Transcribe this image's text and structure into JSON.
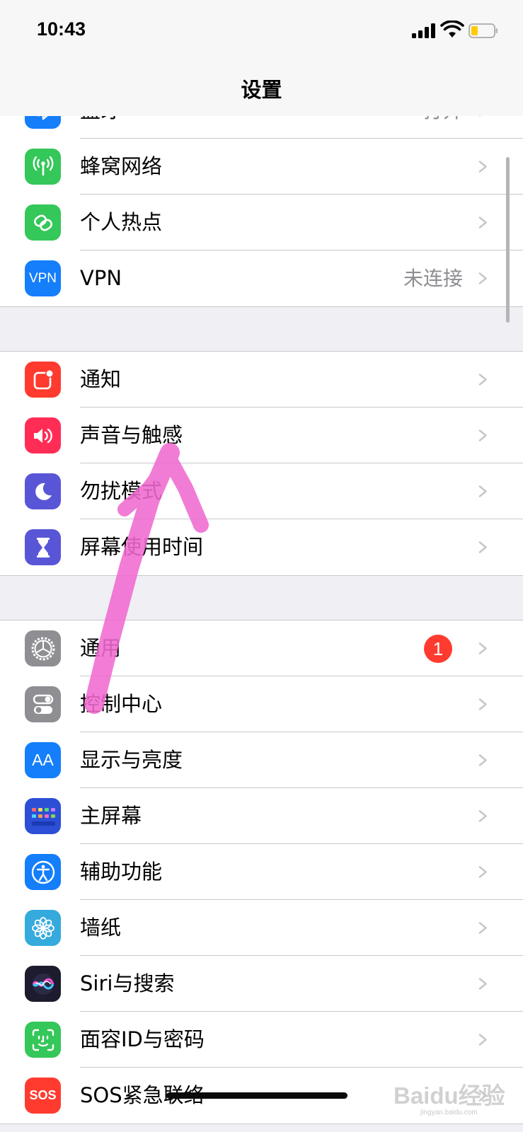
{
  "status_bar": {
    "time": "10:43"
  },
  "nav": {
    "title": "设置"
  },
  "groups": [
    {
      "rows": [
        {
          "id": "bluetooth",
          "label": "蓝牙",
          "value": "打开",
          "icon": "bluetooth-icon",
          "color": "#147efb"
        },
        {
          "id": "cellular",
          "label": "蜂窝网络",
          "icon": "antenna-icon",
          "color": "#34c759"
        },
        {
          "id": "hotspot",
          "label": "个人热点",
          "icon": "hotspot-chain-icon",
          "color": "#34c759"
        },
        {
          "id": "vpn",
          "label": "VPN",
          "value": "未连接",
          "icon": "vpn-icon",
          "icon_text": "VPN",
          "color": "#147efb"
        }
      ]
    },
    {
      "rows": [
        {
          "id": "notifications",
          "label": "通知",
          "icon": "notification-icon",
          "color": "#ff3b30"
        },
        {
          "id": "sounds",
          "label": "声音与触感",
          "icon": "speaker-icon",
          "color": "#ff2d55"
        },
        {
          "id": "dnd",
          "label": "勿扰模式",
          "icon": "moon-icon",
          "color": "#5856d6"
        },
        {
          "id": "screentime",
          "label": "屏幕使用时间",
          "icon": "hourglass-icon",
          "color": "#5856d6"
        }
      ]
    },
    {
      "rows": [
        {
          "id": "general",
          "label": "通用",
          "badge": "1",
          "icon": "gear-icon",
          "color": "#8e8e93"
        },
        {
          "id": "control",
          "label": "控制中心",
          "icon": "toggle-icon",
          "color": "#8e8e93"
        },
        {
          "id": "display",
          "label": "显示与亮度",
          "icon": "text-size-icon",
          "icon_text": "AA",
          "color": "#147efb"
        },
        {
          "id": "homescreen",
          "label": "主屏幕",
          "icon": "app-grid-icon",
          "color": "#2c4fd6"
        },
        {
          "id": "accessibility",
          "label": "辅助功能",
          "icon": "accessibility-icon",
          "color": "#147efb"
        },
        {
          "id": "wallpaper",
          "label": "墙纸",
          "icon": "flower-icon",
          "color": "#35aadc"
        },
        {
          "id": "siri",
          "label": "Siri与搜索",
          "icon": "siri-icon",
          "color": "#1c1c2e"
        },
        {
          "id": "faceid",
          "label": "面容ID与密码",
          "icon": "faceid-icon",
          "color": "#34c759"
        },
        {
          "id": "sos",
          "label": "SOS紧急联络",
          "icon": "sos-icon",
          "icon_text": "SOS",
          "color": "#ff3b30"
        }
      ]
    }
  ],
  "annotation": {
    "type": "hand-drawn-arrow",
    "color": "#f06ad0"
  },
  "watermark": {
    "text": "Baidu经验",
    "url": "jingyan.baidu.com"
  }
}
